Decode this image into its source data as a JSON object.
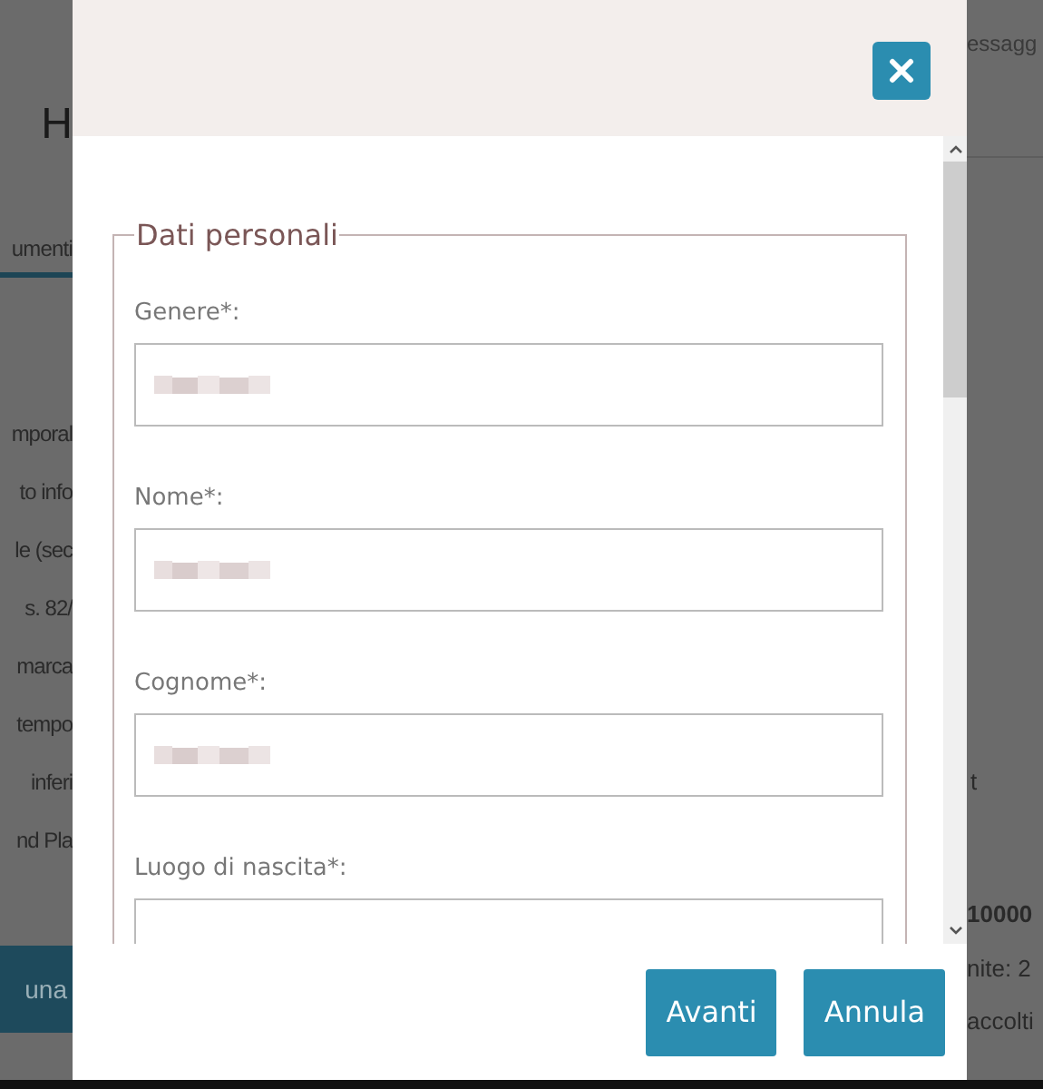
{
  "background": {
    "heading": "H",
    "tab": "umenti",
    "lines": [
      "mporal",
      "to info",
      "le (sec",
      "s. 82/",
      "marca",
      "tempo",
      "inferi",
      "nd Pla"
    ],
    "button": "una",
    "right_top": "essagg",
    "right_lines": [
      "t",
      "10000",
      "nite: 2",
      "accolti"
    ]
  },
  "dialog": {
    "fieldset": "Dati personali",
    "fields": [
      {
        "label": "Genere*:",
        "redacted": true
      },
      {
        "label": "Nome*:",
        "redacted": true
      },
      {
        "label": "Cognome*:",
        "redacted": true
      },
      {
        "label": "Luogo di nascita*:"
      }
    ],
    "buttons": [
      "Avanti",
      "Annula"
    ]
  }
}
